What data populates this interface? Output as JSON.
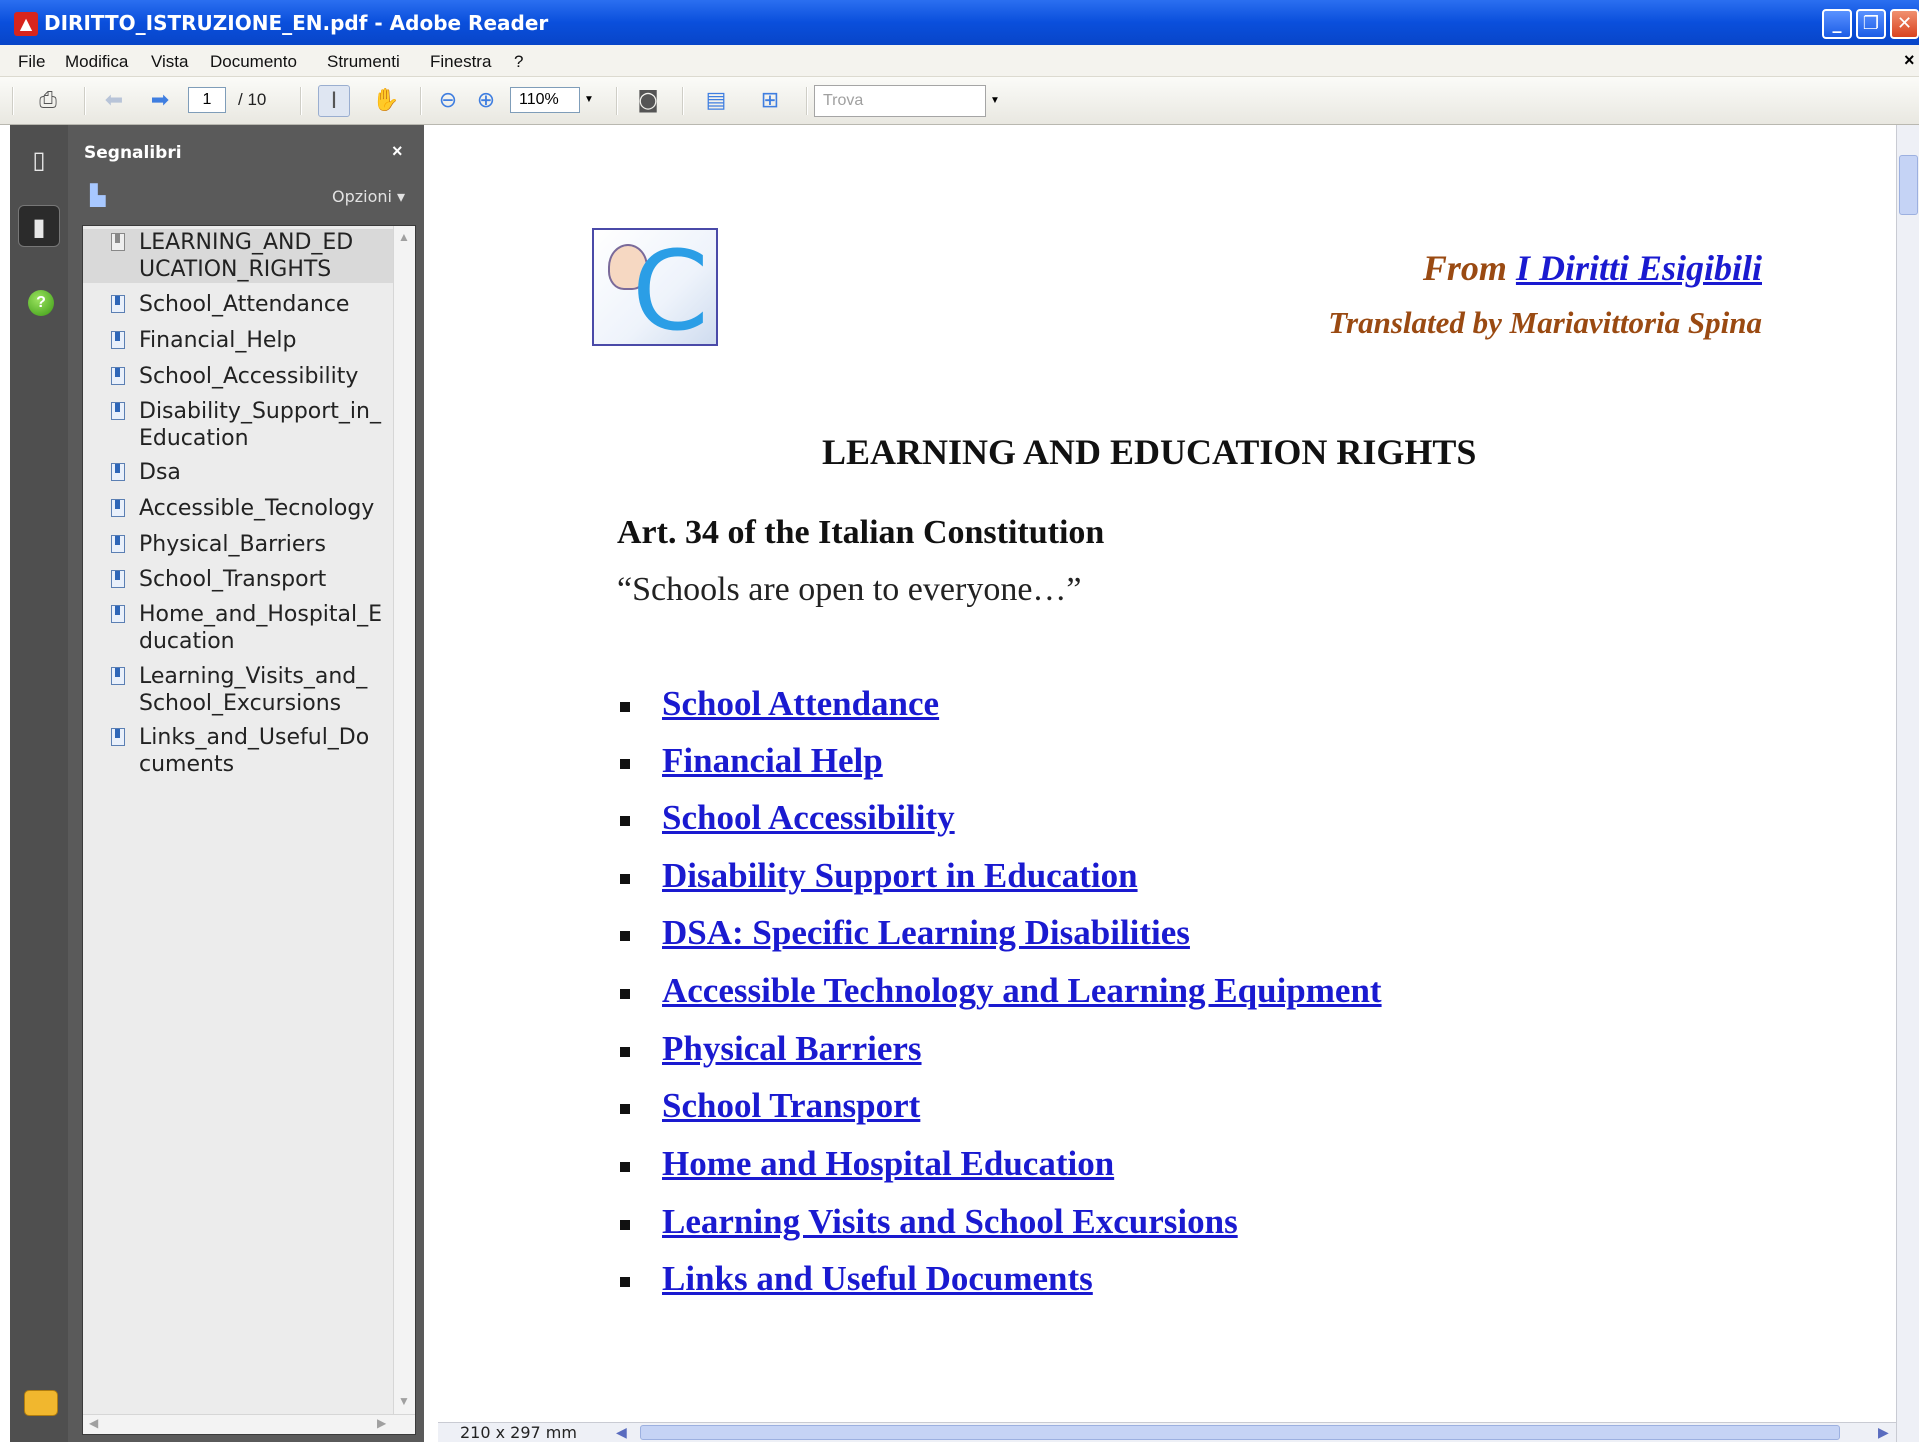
{
  "window": {
    "title": "DIRITTO_ISTRUZIONE_EN.pdf - Adobe Reader",
    "app_icon": "adobe-reader-icon",
    "buttons": [
      "minimize-icon",
      "restore-icon",
      "close-icon"
    ]
  },
  "menubar": {
    "items": [
      "File",
      "Modifica",
      "Vista",
      "Documento",
      "Strumenti",
      "Finestra",
      "?"
    ],
    "close_glyph": "×"
  },
  "toolbar": {
    "current_page": "1",
    "total_pages": "/ 10",
    "zoom": "110%",
    "find_placeholder": "Trova"
  },
  "bookmarks_panel": {
    "title": "Segnalibri",
    "options_label": "Opzioni ▾",
    "items": [
      {
        "label": "LEARNING_AND_ED\nUCATION_RIGHTS",
        "selected": true
      },
      {
        "label": "School_Attendance"
      },
      {
        "label": "Financial_Help"
      },
      {
        "label": "School_Accessibility"
      },
      {
        "label": "Disability_Support_in_\nEducation"
      },
      {
        "label": "Dsa"
      },
      {
        "label": "Accessible_Tecnology"
      },
      {
        "label": "Physical_Barriers"
      },
      {
        "label": "School_Transport"
      },
      {
        "label": "Home_and_Hospital_E\nducation"
      },
      {
        "label": "Learning_Visits_and_\nSchool_Excursions"
      },
      {
        "label": "Links_and_Useful_Do\ncuments"
      }
    ]
  },
  "status": {
    "page_size": "210 x 297 mm"
  },
  "document": {
    "from_prefix": "From ",
    "from_link": "I Diritti Esigibili",
    "translated_by": "Translated by Mariavittoria Spina",
    "title": "LEARNING AND EDUCATION RIGHTS",
    "article": "Art. 34 of the Italian Constitution",
    "quote": "“Schools are open to everyone…”",
    "toc": [
      "School Attendance",
      "Financial Help",
      "School Accessibility",
      "Disability Support in Education",
      "DSA: Specific Learning Disabilities",
      "Accessible Technology and Learning Equipment",
      "Physical Barriers",
      "School Transport",
      "Home and Hospital Education",
      "Learning Visits and School Excursions",
      "Links and Useful Documents"
    ]
  },
  "colors": {
    "titlebar": "#0a4fdc",
    "link": "#1a1ad0",
    "credit": "#9a4a12",
    "panel": "#5a5a5a"
  }
}
